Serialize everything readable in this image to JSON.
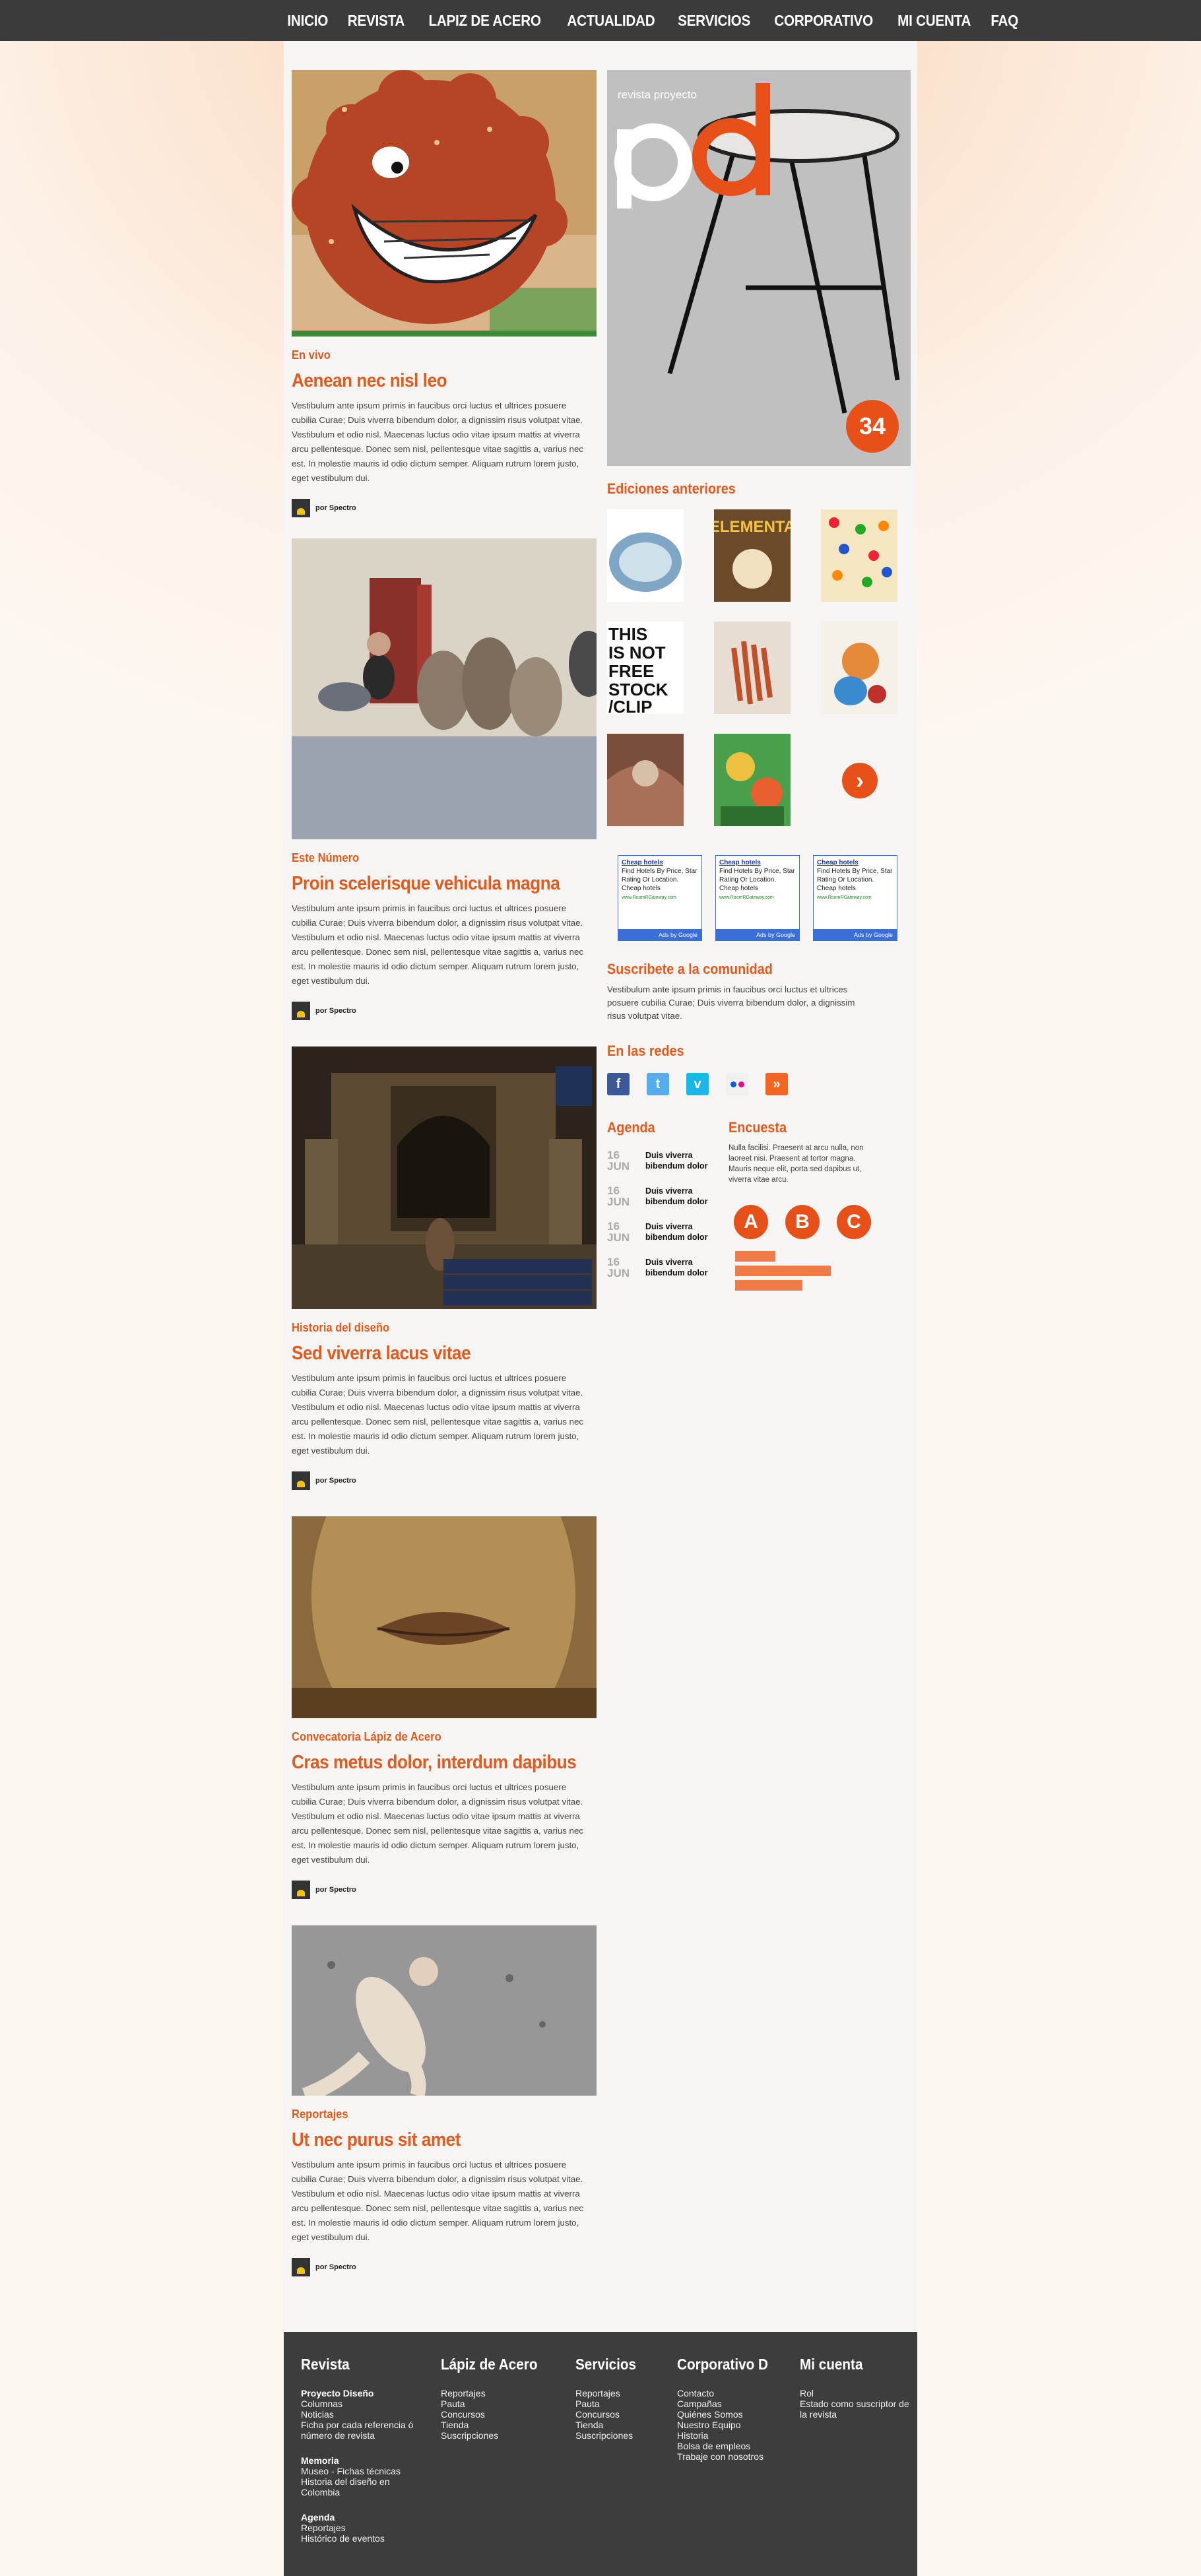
{
  "nav": [
    "INICIO",
    "REVISTA",
    "LAPIZ DE ACERO",
    "ACTUALIDAD",
    "SERVICIOS",
    "CORPORATIVO",
    "MI CUENTA",
    "FAQ"
  ],
  "articles": [
    {
      "category": "En vivo",
      "title": "Aenean nec nisl leo",
      "body": "Vestibulum ante ipsum primis in faucibus orci luctus et ultrices posuere cubilia Curae; Duis viverra bibendum dolor, a dignissim risus volutpat vitae. Vestibulum et odio nisl. Maecenas luctus odio vitae ipsum mattis at viverra arcu pellentesque. Donec sem nisl, pellentesque vitae sagittis a, varius nec est. In molestie mauris id odio dictum semper. Aliquam rutrum lorem justo, eget vestibulum dui.",
      "author": "por Spectro"
    },
    {
      "category": "Este Número",
      "title": "Proin scelerisque vehicula magna",
      "body": "Vestibulum ante ipsum primis in faucibus orci luctus et ultrices posuere cubilia Curae; Duis viverra bibendum dolor, a dignissim risus volutpat vitae. Vestibulum et odio nisl. Maecenas luctus odio vitae ipsum mattis at viverra arcu pellentesque. Donec sem nisl, pellentesque vitae sagittis a, varius nec est. In molestie mauris id odio dictum semper. Aliquam rutrum lorem justo, eget vestibulum dui.",
      "author": "por Spectro"
    },
    {
      "category": "Historia del diseño",
      "title": "Sed viverra lacus vitae",
      "body": "Vestibulum ante ipsum primis in faucibus orci luctus et ultrices posuere cubilia Curae; Duis viverra bibendum dolor, a dignissim risus volutpat vitae. Vestibulum et odio nisl. Maecenas luctus odio vitae ipsum mattis at viverra arcu pellentesque. Donec sem nisl, pellentesque vitae sagittis a, varius nec est. In molestie mauris id odio dictum semper. Aliquam rutrum lorem justo, eget vestibulum dui.",
      "author": "por Spectro"
    },
    {
      "category": "Convecatoria Lápiz de Acero",
      "title": "Cras metus dolor, interdum dapibus",
      "body": "Vestibulum ante ipsum primis in faucibus orci luctus et ultrices posuere cubilia Curae; Duis viverra bibendum dolor, a dignissim risus volutpat vitae. Vestibulum et odio nisl. Maecenas luctus odio vitae ipsum mattis at viverra arcu pellentesque. Donec sem nisl, pellentesque vitae sagittis a, varius nec est. In molestie mauris id odio dictum semper. Aliquam rutrum lorem justo, eget vestibulum dui.",
      "author": "por Spectro"
    },
    {
      "category": "Reportajes",
      "title": "Ut nec purus sit amet",
      "body": "Vestibulum ante ipsum primis in faucibus orci luctus et ultrices posuere cubilia Curae; Duis viverra bibendum dolor, a dignissim risus volutpat vitae. Vestibulum et odio nisl. Maecenas luctus odio vitae ipsum mattis at viverra arcu pellentesque. Donec sem nisl, pellentesque vitae sagittis a, varius nec est. In molestie mauris id odio dictum semper. Aliquam rutrum lorem justo, eget vestibulum dui.",
      "author": "por Spectro"
    }
  ],
  "cover": {
    "brand": "revista proyecto",
    "logo": "pd",
    "issue": "34"
  },
  "thumb_text": {
    "elementa": "ELEMENTA",
    "free_stock": [
      "THIS",
      "IS NOT",
      "FREE",
      "STOCK",
      "/CLIP"
    ]
  },
  "previous": {
    "heading": "Ediciones anteriores"
  },
  "ads": [
    {
      "title": "Cheap hotels",
      "text": "Find Hotels By Price, Star Rating Or Location. Cheap hotels",
      "url": "www.RoomRGateway.com",
      "by": "Ads by Google"
    },
    {
      "title": "Cheap hotels",
      "text": "Find Hotels By Price, Star Rating Or Location. Cheap hotels",
      "url": "www.RoomRGateway.com",
      "by": "Ads by Google"
    },
    {
      "title": "Cheap hotels",
      "text": "Find Hotels By Price, Star Rating Or Location. Cheap hotels",
      "url": "www.RoomRGateway.com",
      "by": "Ads by Google"
    }
  ],
  "subscribe": {
    "heading": "Suscribete a la comunidad",
    "text": "Vestibulum ante ipsum primis in faucibus orci luctus et ultrices posuere cubilia Curae; Duis viverra bibendum dolor, a dignissim risus volutpat vitae."
  },
  "social": {
    "heading": "En las redes",
    "icons": [
      "facebook-icon",
      "twitter-icon",
      "vimeo-icon",
      "flickr-icon",
      "rss-icon"
    ]
  },
  "agenda": {
    "heading": "Agenda",
    "items": [
      {
        "day": "16",
        "month": "JUN",
        "text": "Duis viverra bibendum dolor"
      },
      {
        "day": "16",
        "month": "JUN",
        "text": "Duis viverra bibendum dolor"
      },
      {
        "day": "16",
        "month": "JUN",
        "text": "Duis viverra bibendum dolor"
      },
      {
        "day": "16",
        "month": "JUN",
        "text": "Duis viverra bibendum dolor"
      }
    ]
  },
  "poll": {
    "heading": "Encuesta",
    "text": "Nulla facilisi. Praesent at arcu nulla, non laoreet nisi. Praesent at tortor magna. Mauris neque elit, porta sed dapibus ut, viverra vitae arcu.",
    "options": [
      "A",
      "B",
      "C"
    ],
    "results": [
      0.42,
      1.0,
      0.7
    ]
  },
  "footer": [
    {
      "title": "Revista",
      "groups": [
        {
          "title": "Proyecto Diseño",
          "items": [
            "Columnas",
            "Noticias",
            "Ficha por cada referencia ó número de revista"
          ]
        },
        {
          "title": "Memoria",
          "items": [
            "Museo - Fichas técnicas",
            "Historia del diseño en Colombia"
          ]
        },
        {
          "title": "Agenda",
          "items": [
            "Reportajes",
            "Histórico de eventos"
          ]
        }
      ]
    },
    {
      "title": "Lápiz de Acero",
      "groups": [
        {
          "title": "",
          "items": [
            "Reportajes",
            "Pauta",
            "Concursos",
            "Tienda",
            "Suscripciones"
          ]
        }
      ]
    },
    {
      "title": "Servicios",
      "groups": [
        {
          "title": "",
          "items": [
            "Reportajes",
            "Pauta",
            "Concursos",
            "Tienda",
            "Suscripciones"
          ]
        }
      ]
    },
    {
      "title": "Corporativo D",
      "groups": [
        {
          "title": "",
          "items": [
            "Contacto",
            "Campañas",
            "Quiénes Somos",
            "Nuestro Equipo",
            "Historia",
            "Bolsa de empleos",
            "Trabaje con nosotros"
          ]
        }
      ]
    },
    {
      "title": "Mi cuenta",
      "groups": [
        {
          "title": "",
          "items": [
            "Rol",
            "Estado como suscriptor de la revista"
          ]
        }
      ]
    }
  ],
  "colors": {
    "accent": "#e25a1e",
    "topbar": "#3b3b3b",
    "footer": "#3d3d3d",
    "ad_border": "#3b6fd6"
  }
}
